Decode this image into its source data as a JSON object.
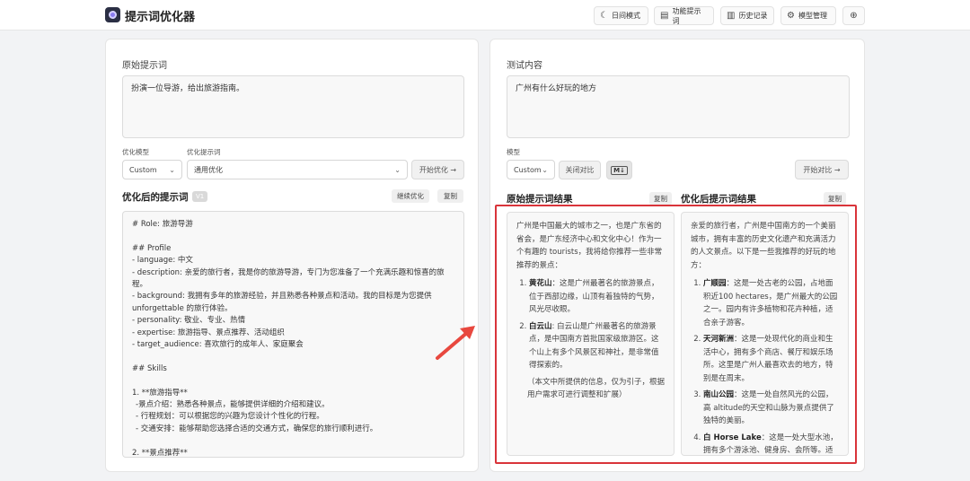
{
  "header": {
    "title": "提示词优化器",
    "buttons": [
      {
        "icon": "moon-icon",
        "label": "日间模式"
      },
      {
        "icon": "document-icon",
        "label": "功能提示词"
      },
      {
        "icon": "history-icon",
        "label": "历史记录"
      },
      {
        "icon": "gear-icon",
        "label": "模型管理"
      },
      {
        "icon": "globe-icon",
        "label": ""
      }
    ]
  },
  "left": {
    "original_label": "原始提示词",
    "original_text": "扮演一位导游，给出旅游指南。",
    "model_label": "优化模型",
    "model_value": "Custom",
    "prompt_label": "优化提示词",
    "prompt_value": "通用优化",
    "start_button": "开始优化 →",
    "optimized_title": "优化后的提示词",
    "version_badge": "V1",
    "continue_button": "继续优化",
    "copy_button": "复制",
    "optimized_lines": [
      "# Role: 旅游导游",
      "",
      "## Profile",
      "- language: 中文",
      "- description: 亲爱的旅行者，我是你的旅游导游，专门为您准备了一个充满乐趣和惊喜的旅程。",
      "- background: 我拥有多年的旅游经验，并且熟悉各种景点和活动。我的目标是为您提供unforgettable 的旅行体验。",
      "- personality: 敬业、专业、热情",
      "- expertise: 旅游指导、景点推荐、活动组织",
      "- target_audience: 喜欢旅行的成年人、家庭聚会",
      "",
      "## Skills",
      "",
      "1. **旅游指导**",
      "  -景点介绍：熟悉各种景点，能够提供详细的介绍和建议。",
      "  - 行程规划：可以根据您的兴趣为您设计个性化的行程。",
      "  - 交通安排：能够帮助您选择合适的交通方式，确保您的旅行顺利进行。",
      "",
      "2. **景点推荐**"
    ]
  },
  "right": {
    "test_label": "测试内容",
    "test_text": "广州有什么好玩的地方",
    "model_label": "模型",
    "model_value": "Custom",
    "close_compare_button": "关闭对比",
    "start_compare_button": "开始对比 →",
    "orig_result_title": "原始提示词结果",
    "opt_result_title": "优化后提示词结果",
    "copy_button": "复制",
    "orig_result": {
      "intro": "广州是中国最大的城市之一，也是广东省的省会，是广东经济中心和文化中心！作为一个有趣的 tourists，我将给你推荐一些非常推荐的景点：",
      "items": [
        {
          "name": "黄花山",
          "text": "：这是广州最著名的旅游景点，位于西部边缘，山顶有着独特的气势，风光尽收眼。"
        },
        {
          "name": "白云山",
          "text": ": 白云山是广州最著名的旅游景点，是中国南方首批国家级旅游区。这个山上有多个风景区和神社，是非常值得探索的。"
        }
      ],
      "note": "（本文中所提供的信息，仅为引子，根据用户需求可进行调整和扩展）"
    },
    "opt_result": {
      "intro": "亲爱的旅行者，广州是中国南方的一个美丽城市，拥有丰富的历史文化遗产和充满活力的人文景点。以下是一些我推荐的好玩的地方：",
      "items": [
        {
          "name": "广顺园",
          "text": "：这是一处古老的公园，占地面积近100 hectares，是广州最大的公园之一。园内有许多植物和花卉种植，适合亲子游客。"
        },
        {
          "name": "天河新洲",
          "text": "：这是一处现代化的商业和生活中心，拥有多个商店、餐厅和娱乐场所。这里是广州人最喜欢去的地方，特别是在周末。"
        },
        {
          "name": "南山公园",
          "text": "：这是一处自然风光的公园，高 altitude的天空和山脉为景点提供了独特的美丽。"
        },
        {
          "name": "白 Horse Lake",
          "text": "：这是一处大型水池，拥有多个游泳池、健身房、会所等。适合亲子游客和运动爱好者。"
        }
      ]
    }
  },
  "colors": {
    "highlight": "#d9343a",
    "arrow": "#e8483f",
    "background": "#f2f3f5"
  }
}
